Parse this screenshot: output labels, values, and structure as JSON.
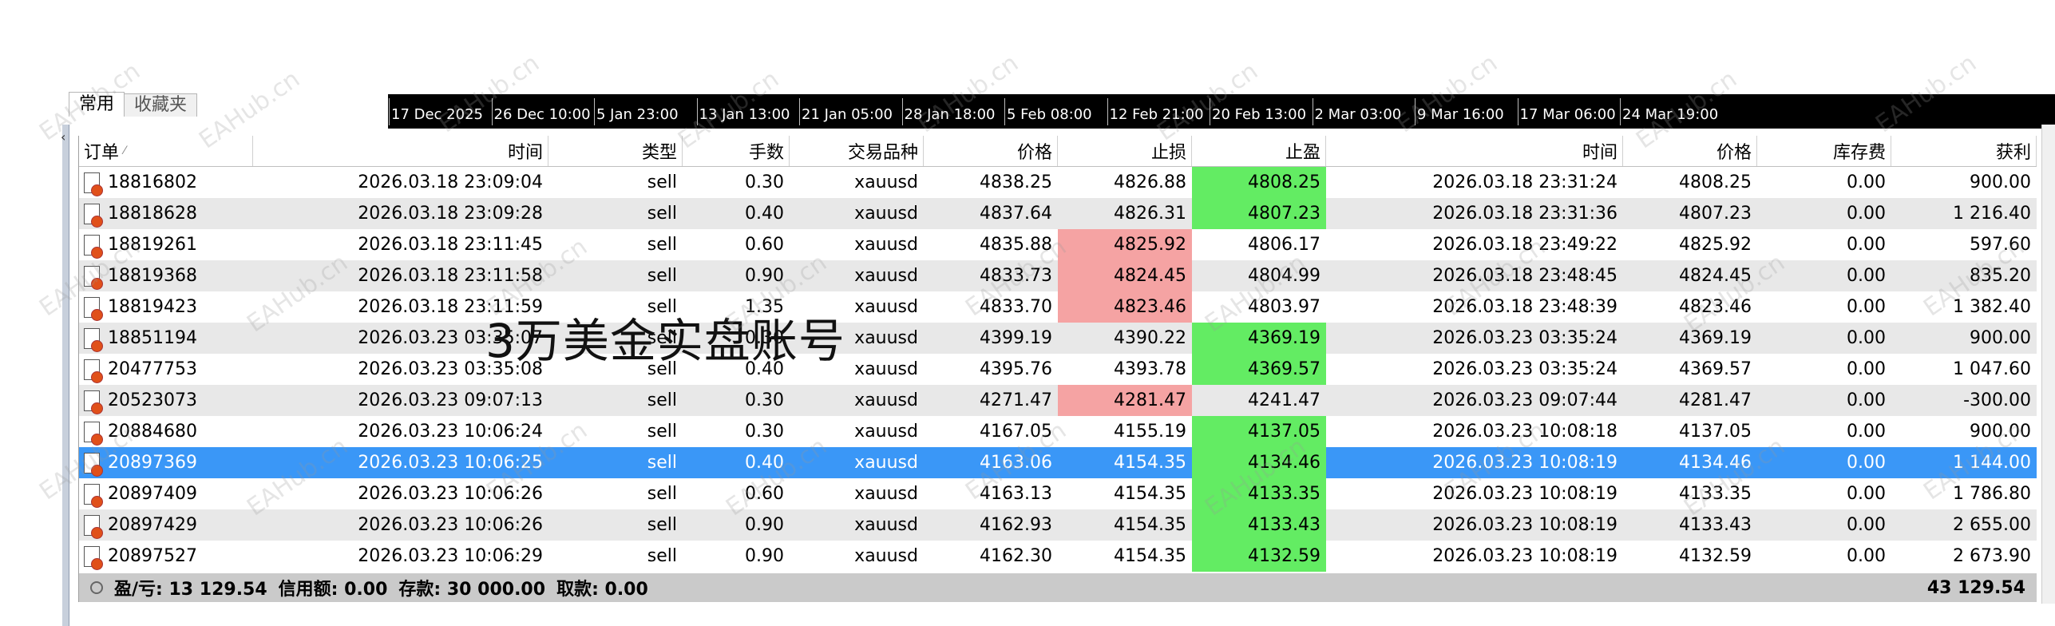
{
  "tabs": [
    "常用",
    "收藏夹"
  ],
  "timeline": [
    "17 Dec 2025",
    "26 Dec 10:00",
    "5 Jan 23:00",
    "13 Jan 13:00",
    "21 Jan 05:00",
    "28 Jan 18:00",
    "5 Feb 08:00",
    "12 Feb 21:00",
    "20 Feb 13:00",
    "2 Mar 03:00",
    "9 Mar 16:00",
    "17 Mar 06:00",
    "24 Mar 19:00"
  ],
  "columns": [
    "订单",
    "时间",
    "类型",
    "手数",
    "交易品种",
    "价格",
    "止损",
    "止盈",
    "时间",
    "价格",
    "库存费",
    "获利"
  ],
  "sort_indicator": "⁄",
  "rows": [
    {
      "order": "18816802",
      "time": "2026.03.18 23:09:04",
      "type": "sell",
      "volume": "0.30",
      "symbol": "xauusd",
      "price": "4838.25",
      "sl": "4826.88",
      "tp": "4808.25",
      "close_time": "2026.03.18 23:31:24",
      "close_price": "4808.25",
      "swap": "0.00",
      "profit": "900.00"
    },
    {
      "order": "18818628",
      "time": "2026.03.18 23:09:28",
      "type": "sell",
      "volume": "0.40",
      "symbol": "xauusd",
      "price": "4837.64",
      "sl": "4826.31",
      "tp": "4807.23",
      "close_time": "2026.03.18 23:31:36",
      "close_price": "4807.23",
      "swap": "0.00",
      "profit": "1 216.40"
    },
    {
      "order": "18819261",
      "time": "2026.03.18 23:11:45",
      "type": "sell",
      "volume": "0.60",
      "symbol": "xauusd",
      "price": "4835.88",
      "sl": "4825.92",
      "tp": "4806.17",
      "close_time": "2026.03.18 23:49:22",
      "close_price": "4825.92",
      "swap": "0.00",
      "profit": "597.60"
    },
    {
      "order": "18819368",
      "time": "2026.03.18 23:11:58",
      "type": "sell",
      "volume": "0.90",
      "symbol": "xauusd",
      "price": "4833.73",
      "sl": "4824.45",
      "tp": "4804.99",
      "close_time": "2026.03.18 23:48:45",
      "close_price": "4824.45",
      "swap": "0.00",
      "profit": "835.20"
    },
    {
      "order": "18819423",
      "time": "2026.03.18 23:11:59",
      "type": "sell",
      "volume": "1.35",
      "symbol": "xauusd",
      "price": "4833.70",
      "sl": "4823.46",
      "tp": "4803.97",
      "close_time": "2026.03.18 23:48:39",
      "close_price": "4823.46",
      "swap": "0.00",
      "profit": "1 382.40"
    },
    {
      "order": "18851194",
      "time": "2026.03.23 03:35:07",
      "type": "sell",
      "volume": "0.30",
      "symbol": "xauusd",
      "price": "4399.19",
      "sl": "4390.22",
      "tp": "4369.19",
      "close_time": "2026.03.23 03:35:24",
      "close_price": "4369.19",
      "swap": "0.00",
      "profit": "900.00"
    },
    {
      "order": "20477753",
      "time": "2026.03.23 03:35:08",
      "type": "sell",
      "volume": "0.40",
      "symbol": "xauusd",
      "price": "4395.76",
      "sl": "4393.78",
      "tp": "4369.57",
      "close_time": "2026.03.23 03:35:24",
      "close_price": "4369.57",
      "swap": "0.00",
      "profit": "1 047.60"
    },
    {
      "order": "20523073",
      "time": "2026.03.23 09:07:13",
      "type": "sell",
      "volume": "0.30",
      "symbol": "xauusd",
      "price": "4271.47",
      "sl": "4281.47",
      "tp": "4241.47",
      "close_time": "2026.03.23 09:07:44",
      "close_price": "4281.47",
      "swap": "0.00",
      "profit": "-300.00"
    },
    {
      "order": "20884680",
      "time": "2026.03.23 10:06:24",
      "type": "sell",
      "volume": "0.30",
      "symbol": "xauusd",
      "price": "4167.05",
      "sl": "4155.19",
      "tp": "4137.05",
      "close_time": "2026.03.23 10:08:18",
      "close_price": "4137.05",
      "swap": "0.00",
      "profit": "900.00"
    },
    {
      "order": "20897369",
      "time": "2026.03.23 10:06:25",
      "type": "sell",
      "volume": "0.40",
      "symbol": "xauusd",
      "price": "4163.06",
      "sl": "4154.35",
      "tp": "4134.46",
      "close_time": "2026.03.23 10:08:19",
      "close_price": "4134.46",
      "swap": "0.00",
      "profit": "1 144.00"
    },
    {
      "order": "20897409",
      "time": "2026.03.23 10:06:26",
      "type": "sell",
      "volume": "0.60",
      "symbol": "xauusd",
      "price": "4163.13",
      "sl": "4154.35",
      "tp": "4133.35",
      "close_time": "2026.03.23 10:08:19",
      "close_price": "4133.35",
      "swap": "0.00",
      "profit": "1 786.80"
    },
    {
      "order": "20897429",
      "time": "2026.03.23 10:06:26",
      "type": "sell",
      "volume": "0.90",
      "symbol": "xauusd",
      "price": "4162.93",
      "sl": "4154.35",
      "tp": "4133.43",
      "close_time": "2026.03.23 10:08:19",
      "close_price": "4133.43",
      "swap": "0.00",
      "profit": "2 655.00"
    },
    {
      "order": "20897527",
      "time": "2026.03.23 10:06:29",
      "type": "sell",
      "volume": "0.90",
      "symbol": "xauusd",
      "price": "4162.30",
      "sl": "4154.35",
      "tp": "4132.59",
      "close_time": "2026.03.23 10:08:19",
      "close_price": "4132.59",
      "swap": "0.00",
      "profit": "2 673.90"
    }
  ],
  "summary": {
    "pnl": "盈/亏: 13 129.54",
    "credit": "信用额: 0.00",
    "deposit": "存款: 30 000.00",
    "withdrawal": "取款: 0.00",
    "total": "43 129.54"
  },
  "overlay_text": "3万美金实盘账号",
  "watermark": "EAHub.cn",
  "colors": {
    "selected_row": "#3a97f7",
    "sl_hit": "#f5a3a3",
    "tp_hit": "#63ec63",
    "alt_row": "#e8e8e8",
    "summary_bg": "#cacaca"
  }
}
